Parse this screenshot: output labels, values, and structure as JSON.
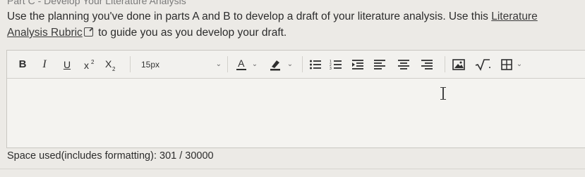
{
  "heading": "Part C - Develop Your Literature Analysis",
  "instructions": {
    "before_link": "Use the planning you've done in parts A and B to develop a draft of your literature analysis. Use this ",
    "link_text": "Literature Analysis Rubric",
    "after_link": " to guide you as you develop your draft."
  },
  "toolbar": {
    "bold": "B",
    "italic": "I",
    "underline": "U",
    "font_size_value": "15px",
    "text_color_letter": "A"
  },
  "editor": {
    "content": ""
  },
  "status": {
    "space_used": "Space used(includes formatting): 301 / 30000"
  }
}
